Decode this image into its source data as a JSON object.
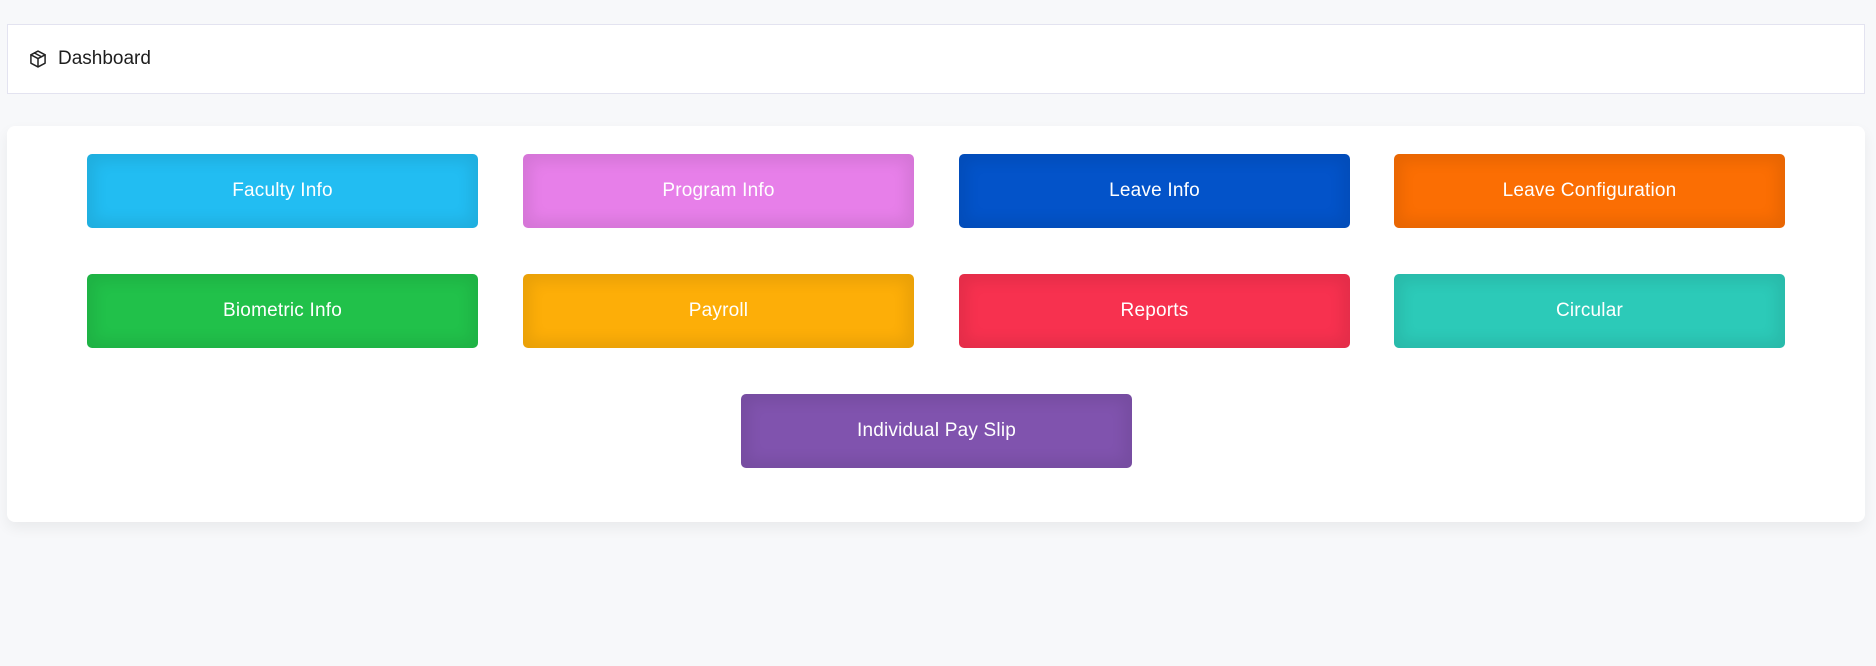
{
  "breadcrumb": {
    "icon": "cube-icon",
    "label": "Dashboard"
  },
  "tiles": [
    {
      "label": "Faculty Info",
      "color": "#22bdf2"
    },
    {
      "label": "Program Info",
      "color": "#e77fe9"
    },
    {
      "label": "Leave Info",
      "color": "#0353c9"
    },
    {
      "label": "Leave Configuration",
      "color": "#fb6e03"
    },
    {
      "label": "Biometric Info",
      "color": "#21c14a"
    },
    {
      "label": "Payroll",
      "color": "#fdae08"
    },
    {
      "label": "Reports",
      "color": "#f7314f"
    },
    {
      "label": "Circular",
      "color": "#2ccab8"
    },
    {
      "label": "Individual Pay Slip",
      "color": "#8053ae"
    }
  ]
}
